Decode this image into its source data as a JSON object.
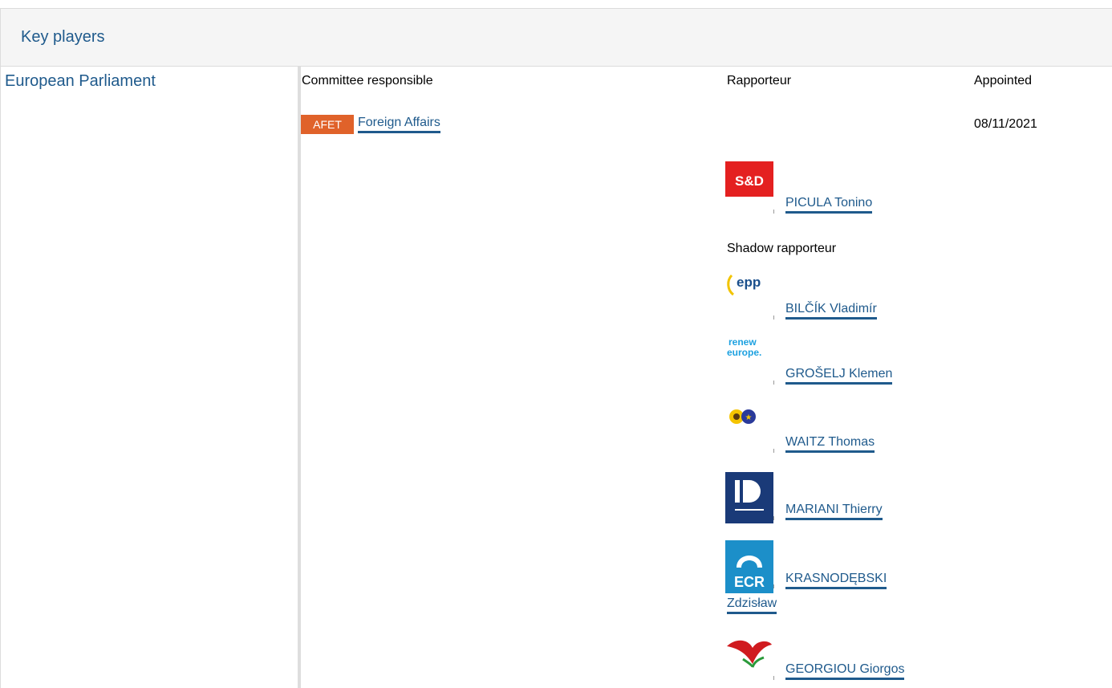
{
  "header": {
    "title": "Key players"
  },
  "institution": {
    "name": "European Parliament"
  },
  "columns": {
    "committee": "Committee responsible",
    "rapporteur": "Rapporteur",
    "appointed": "Appointed"
  },
  "committee": {
    "badge": "AFET",
    "badge_color": "#e0622a",
    "name": "Foreign Affairs",
    "appointed_date": "08/11/2021"
  },
  "rapporteur": {
    "group_logo": "S&D",
    "name": "PICULA Tonino"
  },
  "shadow_label": "Shadow rapporteur",
  "shadows": [
    {
      "group_logo_text": "epp",
      "name": "BILČÍK Vladimír"
    },
    {
      "group_logo_text": "renew europe.",
      "name": "GROŠELJ Klemen"
    },
    {
      "group_logo_text": "greens-efa",
      "name": "WAITZ Thomas"
    },
    {
      "group_logo_text": "ID",
      "name": "MARIANI Thierry"
    },
    {
      "group_logo_text": "ECR",
      "name_line1": "KRASNODĘBSKI",
      "name_line2": "Zdzisław"
    },
    {
      "group_logo_text": "left",
      "name": "GEORGIOU Giorgos"
    }
  ]
}
